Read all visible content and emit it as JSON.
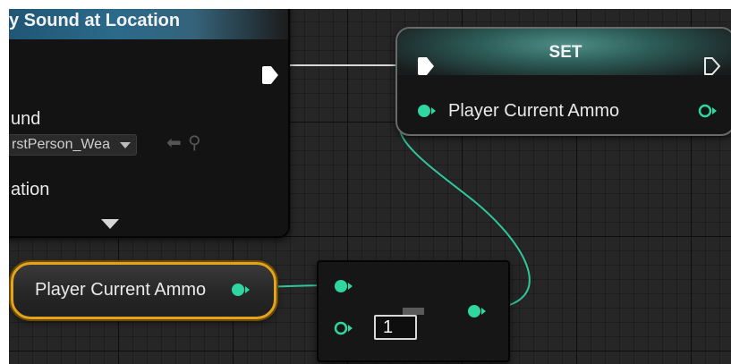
{
  "sound_node": {
    "title": "y Sound at Location",
    "sound_pin_label": "und",
    "sound_asset_value": "rstPerson_Wea",
    "location_pin_label": "ation"
  },
  "set_node": {
    "title": "SET",
    "pin_label": "Player Current Ammo"
  },
  "getter_node": {
    "label": "Player Current Ammo"
  },
  "add_node": {
    "value": "1"
  },
  "colors": {
    "pin_green": "#2fd6a0",
    "wire_green": "#2fc79a",
    "exec_white": "#ffffff",
    "getter_highlight": "#e3a31a"
  }
}
